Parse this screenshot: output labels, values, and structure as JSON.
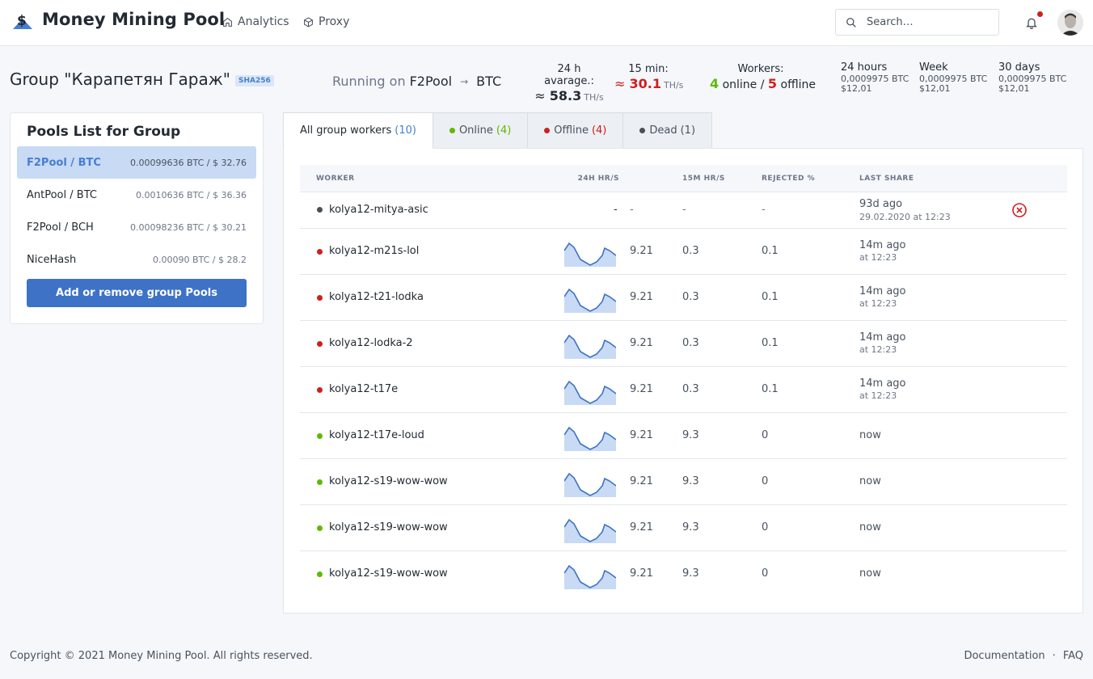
{
  "app": {
    "title": "Money Mining Pool"
  },
  "nav": {
    "analytics": "Analytics",
    "proxy": "Proxy"
  },
  "search": {
    "placeholder": "Search…"
  },
  "group": {
    "title": "Group \"Карапетян Гараж\"",
    "algo": "SHA256",
    "running_prefix": "Running on",
    "pool": "F2Pool",
    "coin": "BTC"
  },
  "stats": {
    "avg24_label": "24 h avarage.:",
    "avg24_approx": "≈",
    "avg24_value": "58.3",
    "avg24_unit": "TH/s",
    "min15_label": "15 min:",
    "min15_approx": "≈",
    "min15_value": "30.1",
    "min15_unit": "TH/s",
    "workers_label": "Workers:",
    "workers_online": "4",
    "workers_online_label": "online /",
    "workers_offline": "5",
    "workers_offline_label": "offline"
  },
  "earnings": [
    {
      "label": "24 hours",
      "btc": "0,0009975 BTC",
      "usd": "$12,01"
    },
    {
      "label": "Week",
      "btc": "0,0009975 BTC",
      "usd": "$12,01"
    },
    {
      "label": "30 days",
      "btc": "0,0009975 BTC",
      "usd": "$12,01"
    }
  ],
  "pools": {
    "title": "Pools List for Group",
    "items": [
      {
        "name": "F2Pool / BTC",
        "value": "0.00099636 BTC / $ 32.76",
        "active": true
      },
      {
        "name": "AntPool / BTC",
        "value": "0.0010636 BTC / $ 36.36"
      },
      {
        "name": "F2Pool / BCH",
        "value": "0.00098236 BTC / $ 30.21"
      },
      {
        "name": "NiceHash",
        "value": "0.00090 BTC / $ 28.2"
      }
    ],
    "add_button": "Add or remove group Pools"
  },
  "tabs": [
    {
      "label": "All group workers",
      "count": "(10)"
    },
    {
      "label": "Online",
      "count": "(4)"
    },
    {
      "label": "Offline",
      "count": "(4)"
    },
    {
      "label": "Dead",
      "count": "(1)"
    }
  ],
  "table": {
    "headers": [
      "WORKER",
      "24H HR/S",
      "15M HR/S",
      "REJECTED %",
      "LAST SHARE"
    ],
    "rows": [
      {
        "status": "dead",
        "name": "kolya12-mitya-asic",
        "spark_dash": "-",
        "hr24": "-",
        "hr15": "-",
        "rejected": "-",
        "last": "93d ago",
        "last_sub": "29.02.2020 at 12:23"
      },
      {
        "status": "offline",
        "name": "kolya12-m21s-lol",
        "hr24": "9.21",
        "hr15": "0.3",
        "rejected": "0.1",
        "last": "14m ago",
        "last_sub": "at 12:23"
      },
      {
        "status": "offline",
        "name": "kolya12-t21-lodka",
        "hr24": "9.21",
        "hr15": "0.3",
        "rejected": "0.1",
        "last": "14m ago",
        "last_sub": "at 12:23"
      },
      {
        "status": "offline",
        "name": "kolya12-lodka-2",
        "hr24": "9.21",
        "hr15": "0.3",
        "rejected": "0.1",
        "last": "14m ago",
        "last_sub": "at 12:23"
      },
      {
        "status": "offline",
        "name": "kolya12-t17e",
        "hr24": "9.21",
        "hr15": "0.3",
        "rejected": "0.1",
        "last": "14m ago",
        "last_sub": "at 12:23"
      },
      {
        "status": "online",
        "name": "kolya12-t17e-loud",
        "hr24": "9.21",
        "hr15": "9.3",
        "rejected": "0",
        "last": "now"
      },
      {
        "status": "online",
        "name": "kolya12-s19-wow-wow",
        "hr24": "9.21",
        "hr15": "9.3",
        "rejected": "0",
        "last": "now"
      },
      {
        "status": "online",
        "name": "kolya12-s19-wow-wow",
        "hr24": "9.21",
        "hr15": "9.3",
        "rejected": "0",
        "last": "now"
      },
      {
        "status": "online",
        "name": "kolya12-s19-wow-wow",
        "hr24": "9.21",
        "hr15": "9.3",
        "rejected": "0",
        "last": "now"
      }
    ]
  },
  "footer": {
    "copyright": "Copyright © 2021 Money Mining Pool. All rights reserved.",
    "documentation": "Documentation",
    "separator": "·",
    "faq": "FAQ"
  },
  "colors": {
    "online": "#5eba00",
    "offline": "#cd201f",
    "dead": "#495057",
    "accent": "#467fcf",
    "sparkline": "#3d72c7",
    "sparkline_fill": "#c8daf4"
  }
}
